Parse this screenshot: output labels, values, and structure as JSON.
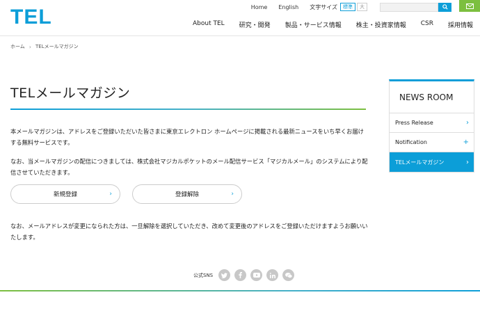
{
  "header": {
    "logo_text": "TEL",
    "util_links": [
      "Home",
      "English"
    ],
    "font_size_label": "文字サイズ",
    "font_size_options": [
      "標準",
      "大"
    ],
    "search_placeholder": ""
  },
  "gnav": [
    "About TEL",
    "研究・開発",
    "製品・サービス情報",
    "株主・投資家情報",
    "CSR",
    "採用情報"
  ],
  "breadcrumb": [
    "ホーム",
    "TELメールマガジン"
  ],
  "main": {
    "title": "TELメールマガジン",
    "para1": "本メールマガジンは、アドレスをご登録いただいた皆さまに東京エレクトロン ホームページに掲載される最新ニュースをいち早くお届けする無料サービスです。",
    "para2": "なお、当メールマガジンの配信につきましては、株式会社マジカルポケットのメール配信サービス「マジカルメール」のシステムにより配信させていただきます。",
    "button_register": "新規登録",
    "button_unsubscribe": "登録解除",
    "para3": "なお、メールアドレスが変更になられた方は、一旦解除を選択していただき、改めて変更後のアドレスをご登録いただけますようお願いいたします。"
  },
  "sns": {
    "label": "公式SNS",
    "icons": [
      "twitter-icon",
      "facebook-icon",
      "youtube-icon",
      "linkedin-icon",
      "wechat-icon"
    ]
  },
  "sidebar": {
    "title": "NEWS ROOM",
    "items": [
      {
        "label": "Press Release",
        "marker": "›"
      },
      {
        "label": "Notification",
        "marker": "+"
      },
      {
        "label": "TELメールマガジン",
        "marker": "›"
      }
    ]
  },
  "colors": {
    "brand_blue": "#0c9ed8",
    "brand_green": "#7cbf3f"
  }
}
